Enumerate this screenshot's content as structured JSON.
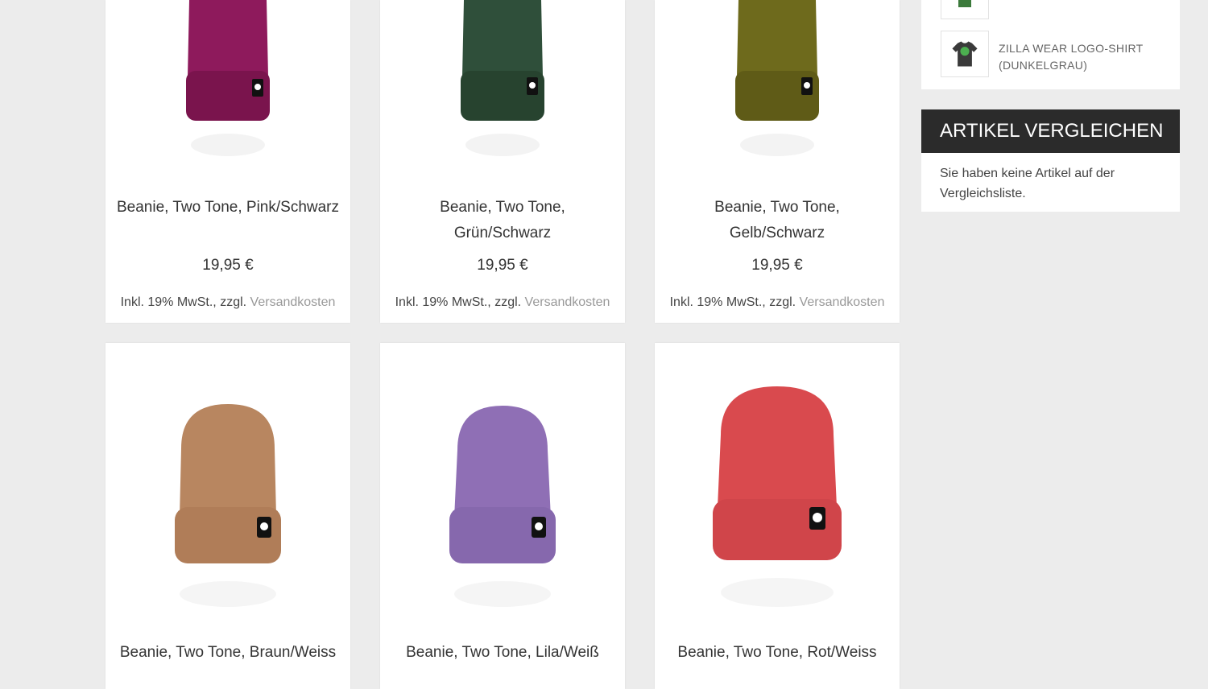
{
  "products": [
    {
      "name": "Beanie, Two Tone, Pink/Schwarz",
      "price": "19,95 €",
      "tax_prefix": "Inkl. 19% MwSt., zzgl.",
      "shipping_link": "Versandkosten",
      "color": "#8e1a5c",
      "cuff_color": "#7a144d",
      "image_icon": "beanie-pink-image"
    },
    {
      "name": "Beanie, Two Tone, Grün/Schwarz",
      "price": "19,95 €",
      "tax_prefix": "Inkl. 19% MwSt., zzgl.",
      "shipping_link": "Versandkosten",
      "color": "#2f4f3a",
      "cuff_color": "#27432f",
      "image_icon": "beanie-green-image"
    },
    {
      "name": "Beanie, Two Tone, Gelb/Schwarz",
      "price": "19,95 €",
      "tax_prefix": "Inkl. 19% MwSt., zzgl.",
      "shipping_link": "Versandkosten",
      "color": "#6e6a1c",
      "cuff_color": "#5f5b17",
      "image_icon": "beanie-olive-image"
    },
    {
      "name": "Beanie, Two Tone, Braun/Weiss",
      "color": "#b88660",
      "cuff_color": "#b07d58",
      "image_icon": "beanie-brown-image"
    },
    {
      "name": "Beanie, Two Tone, Lila/Weiß",
      "color": "#8f6fb5",
      "cuff_color": "#8668ad",
      "image_icon": "beanie-purple-image"
    },
    {
      "name": "Beanie, Two Tone, Rot/Weiss",
      "color": "#d94a4e",
      "cuff_color": "#d0454a",
      "image_icon": "beanie-red-image"
    }
  ],
  "sidebar": {
    "recent_item": {
      "label": "ZILLA WEAR LOGO-SHIRT (DUNKELGRAU)",
      "icon": "tshirt-icon"
    },
    "compare": {
      "title": "ARTIKEL VERGLEICHEN",
      "text": "Sie haben keine Artikel auf der Vergleichsliste."
    }
  }
}
